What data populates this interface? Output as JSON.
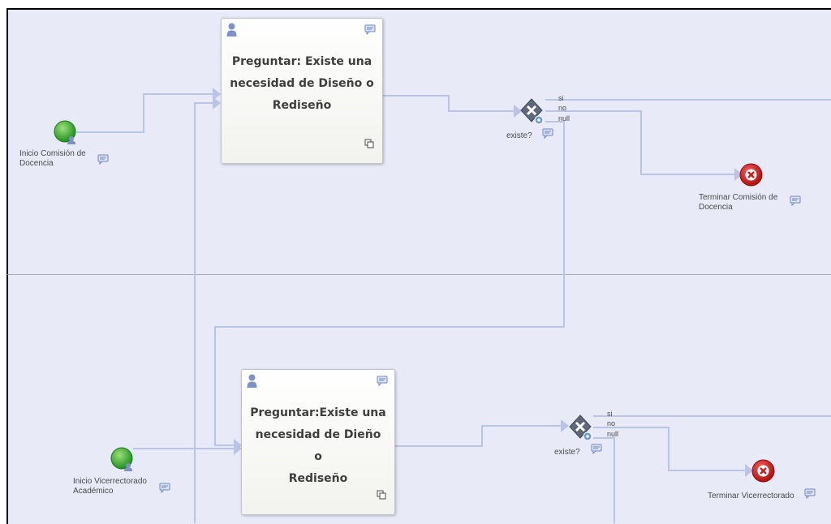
{
  "pools": [
    {
      "task": {
        "label_lines": [
          "Preguntar: Existe una",
          "necesidad de Diseño o",
          "Rediseño"
        ]
      },
      "start_label_lines": [
        "Inicio Comisión de",
        "Docencia"
      ],
      "gateway_label": "existe?",
      "flow_labels": [
        "si",
        "no",
        "null"
      ],
      "end_label_lines": [
        "Terminar Comisión de",
        "Docencia"
      ]
    },
    {
      "task": {
        "label_lines": [
          "Preguntar:Existe una",
          "necesidad de Dieño o",
          "Rediseño"
        ]
      },
      "start_label_lines": [
        "Inicio Vicerrectorado",
        "Académico"
      ],
      "gateway_label": "existe?",
      "flow_labels": [
        "si",
        "no",
        "null"
      ],
      "end_label_lines": [
        "Terminar Vicerrectorado"
      ]
    }
  ],
  "icons": {
    "task_type": "user-task-icon",
    "annotation": "comment-icon",
    "subprocess": "subprocess-icon",
    "start": "start-event-icon",
    "gateway": "exclusive-gateway-icon",
    "end": "terminate-end-event-icon"
  },
  "colors": {
    "lane_background": "#e8eaf8",
    "flow_line": "#b9c4e6",
    "start_event": "#3aa83a",
    "end_event": "#d42020",
    "gateway": "#5f6878",
    "icon_blue": "#7c92c8"
  }
}
